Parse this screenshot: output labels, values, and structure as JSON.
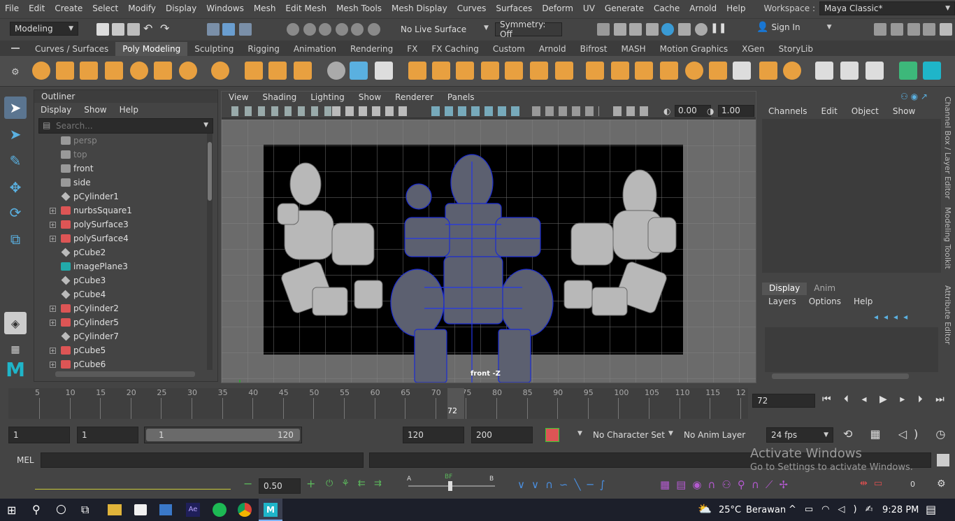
{
  "menubar": {
    "items": [
      "File",
      "Edit",
      "Create",
      "Select",
      "Modify",
      "Display",
      "Windows",
      "Mesh",
      "Edit Mesh",
      "Mesh Tools",
      "Mesh Display",
      "Curves",
      "Surfaces",
      "Deform",
      "UV",
      "Generate",
      "Cache",
      "Arnold",
      "Help"
    ],
    "workspace_label": "Workspace :",
    "workspace_value": "Maya Classic*"
  },
  "statusline": {
    "mode": "Modeling",
    "live_surface": "No Live Surface",
    "symmetry": "Symmetry: Off",
    "sign_in": "Sign In"
  },
  "shelf": {
    "tabs": [
      "Curves / Surfaces",
      "Poly Modeling",
      "Sculpting",
      "Rigging",
      "Animation",
      "Rendering",
      "FX",
      "FX Caching",
      "Custom",
      "Arnold",
      "Bifrost",
      "MASH",
      "Motion Graphics",
      "XGen",
      "StoryLib"
    ],
    "active_tab": "Poly Modeling"
  },
  "outliner": {
    "title": "Outliner",
    "menu": [
      "Display",
      "Show",
      "Help"
    ],
    "search_placeholder": "Search...",
    "items": [
      {
        "label": "persp",
        "icon": "camera-icon",
        "dim": true,
        "expand": false
      },
      {
        "label": "top",
        "icon": "camera-icon",
        "dim": true,
        "expand": false
      },
      {
        "label": "front",
        "icon": "camera-icon",
        "dim": false,
        "expand": false
      },
      {
        "label": "side",
        "icon": "camera-icon",
        "dim": false,
        "expand": false
      },
      {
        "label": "pCylinder1",
        "icon": "mesh-icon",
        "dim": false,
        "expand": false
      },
      {
        "label": "nurbsSquare1",
        "icon": "group-icon",
        "dim": false,
        "expand": true
      },
      {
        "label": "polySurface3",
        "icon": "group-icon",
        "dim": false,
        "expand": true
      },
      {
        "label": "polySurface4",
        "icon": "group-icon",
        "dim": false,
        "expand": true
      },
      {
        "label": "pCube2",
        "icon": "mesh-icon",
        "dim": false,
        "expand": false
      },
      {
        "label": "imagePlane3",
        "icon": "image-plane-icon",
        "dim": false,
        "expand": false
      },
      {
        "label": "pCube3",
        "icon": "mesh-icon",
        "dim": false,
        "expand": false
      },
      {
        "label": "pCube4",
        "icon": "mesh-icon",
        "dim": false,
        "expand": false
      },
      {
        "label": "pCylinder2",
        "icon": "group-icon",
        "dim": false,
        "expand": true
      },
      {
        "label": "pCylinder5",
        "icon": "group-icon",
        "dim": false,
        "expand": true
      },
      {
        "label": "pCylinder7",
        "icon": "mesh-icon",
        "dim": false,
        "expand": false
      },
      {
        "label": "pCube5",
        "icon": "group-icon",
        "dim": false,
        "expand": true
      },
      {
        "label": "pCube6",
        "icon": "group-icon",
        "dim": false,
        "expand": true
      }
    ]
  },
  "viewport": {
    "menu": [
      "View",
      "Shading",
      "Lighting",
      "Show",
      "Renderer",
      "Panels"
    ],
    "field_a": "0.00",
    "field_b": "1.00",
    "camera_label": "front -Z"
  },
  "channelbox": {
    "menu": [
      "Channels",
      "Edit",
      "Object",
      "Show"
    ]
  },
  "sidetabs": [
    "Channel Box / Layer Editor",
    "Modeling Toolkit",
    "Attribute Editor"
  ],
  "layer_editor": {
    "tabs": [
      "Display",
      "Anim"
    ],
    "active_tab": "Display",
    "menu": [
      "Layers",
      "Options",
      "Help"
    ]
  },
  "timeslider": {
    "ticks": [
      "5",
      "10",
      "15",
      "20",
      "25",
      "30",
      "35",
      "40",
      "45",
      "50",
      "55",
      "60",
      "65",
      "70",
      "75",
      "80",
      "85",
      "90",
      "95",
      "100",
      "105",
      "110",
      "115",
      "12"
    ],
    "current_marker": "72",
    "current_frame": "72"
  },
  "range": {
    "start": "1",
    "playback_start": "1",
    "slider_start": "1",
    "slider_end": "120",
    "playback_end": "120",
    "end": "200",
    "character_set": "No Character Set",
    "anim_layer": "No Anim Layer",
    "fps": "24 fps"
  },
  "mel": {
    "label": "MEL"
  },
  "helpline": {
    "value": "0.50",
    "label_a": "A",
    "label_bf": "BF",
    "label_b": "B",
    "right_value": "0"
  },
  "watermark": {
    "line1": "Activate Windows",
    "line2": "Go to Settings to activate Windows."
  },
  "taskbar": {
    "weather": "25°C",
    "weather_text": "Berawan",
    "time": "9:28 PM"
  }
}
